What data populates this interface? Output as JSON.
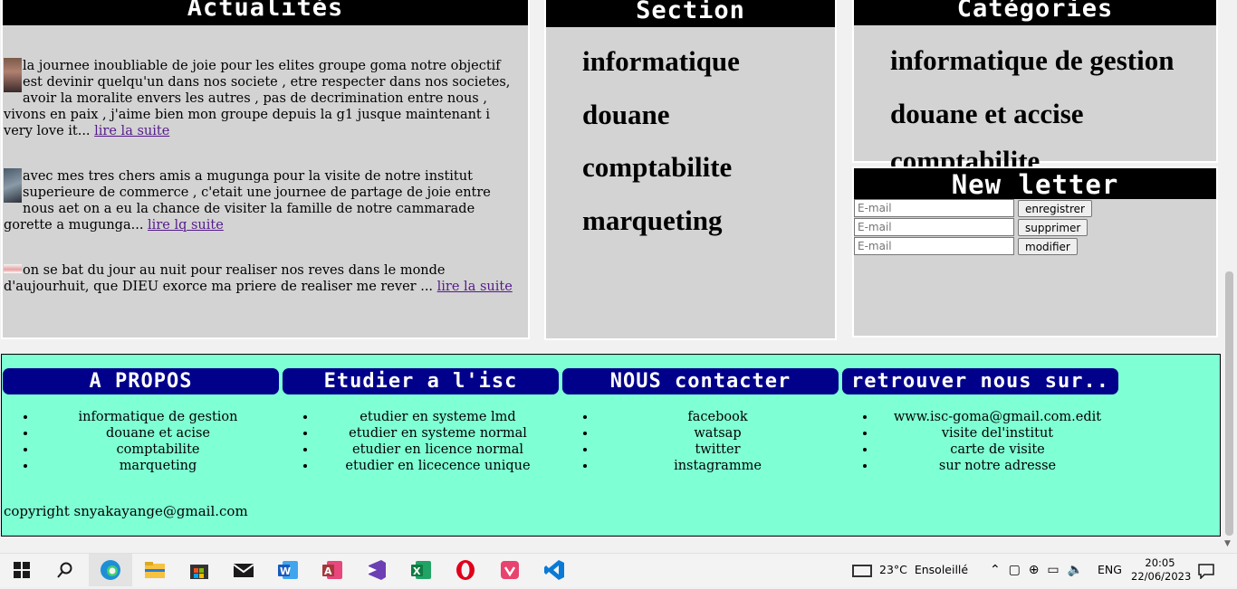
{
  "actualites": {
    "title": "Actualités",
    "items": [
      {
        "text": "la journee inoubliable de joie pour les elites groupe goma notre objectif est devinir quelqu'un dans nos societe , etre respecter dans nos societes, avoir la moralite envers les autres , pas de decrimination entre nous , vivons en paix , j'aime bien mon groupe depuis la g1 jusque maintenant i very love it...",
        "link": "lire la suite"
      },
      {
        "text": "avec mes tres chers amis a mugunga pour la visite de notre institut superieure de commerce , c'etait une journee de partage de joie entre nous aet on a eu la chance de visiter la famille de notre cammarade gorette a mugunga...",
        "link": "lire lq suite"
      },
      {
        "text": "on se bat du jour au nuit pour realiser nos reves dans le monde d'aujourhuit, que DIEU exorce ma priere de realiser me rever ...",
        "link": "lire la suite"
      }
    ]
  },
  "section": {
    "title": "Section",
    "items": [
      "informatique",
      "douane",
      "comptabilite",
      "marqueting"
    ]
  },
  "categories": {
    "title": "Catégories",
    "items": [
      "informatique de gestion",
      "douane et accise"
    ],
    "overflow_item": "comptabilite"
  },
  "newsletter": {
    "title": "New letter",
    "rows": [
      {
        "placeholder": "E-mail",
        "button": "enregistrer"
      },
      {
        "placeholder": "E-mail",
        "button": "supprimer"
      },
      {
        "placeholder": "E-mail",
        "button": "modifier"
      }
    ]
  },
  "footer": {
    "columns": [
      {
        "title": "A PROPOS",
        "items": [
          "informatique de gestion",
          "douane et acise",
          "comptabilite",
          "marqueting"
        ]
      },
      {
        "title": "Etudier a l'isc",
        "items": [
          "etudier en systeme lmd",
          "etudier en systeme normal",
          "etudier en licence normal",
          "etudier en licecence unique"
        ]
      },
      {
        "title": "NOUS contacter",
        "items": [
          "facebook",
          "watsap",
          "twitter",
          "instagramme"
        ]
      },
      {
        "title": "retrouver nous sur..",
        "items": [
          "www.isc-goma@gmail.com.edit",
          "visite del'institut",
          "carte de visite",
          "sur notre adresse"
        ]
      }
    ],
    "copyright": "copyright snyakayange@gmail.com"
  },
  "taskbar": {
    "apps": [
      "start",
      "search",
      "edge",
      "file-explorer",
      "store",
      "mail",
      "word",
      "access",
      "visual-studio",
      "excel",
      "opera",
      "design-app",
      "vscode"
    ],
    "weather": "23°C",
    "weather_desc": "Ensoleillé",
    "lang": "ENG",
    "time": "20:05",
    "date": "22/06/2023"
  },
  "colors": {
    "panel_bg": "#d3d3d3",
    "head_bg": "#000000",
    "footer_bg": "#7fffd4",
    "footer_head_bg": "#00008b",
    "link": "#551a8b"
  }
}
